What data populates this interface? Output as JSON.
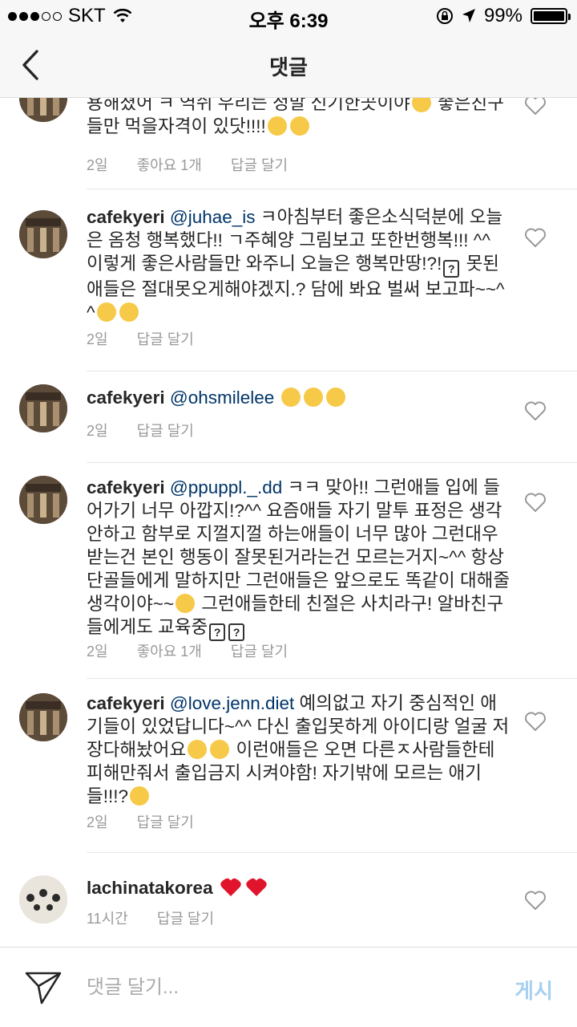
{
  "status": {
    "carrier": "SKT",
    "time": "오후 6:39",
    "battery": "99%",
    "battery_level": 0.99
  },
  "nav": {
    "title": "댓글"
  },
  "comments": [
    {
      "text": "용해졌어 ㅋ 역쉬 우리는 정말 신기한곳이야",
      "text2": " 좋은친구들만 먹을자격이 있닷!!!!",
      "time": "2일",
      "likes": "좋아요 1개",
      "reply": "답글 달기"
    },
    {
      "username": "cafekyeri",
      "mention": "@juhae_is",
      "text": " ㅋ아침부터 좋은소식덕분에 오늘은 옴청 행복했다!! ㄱ주혜양 그림보고 또한번행복!!! ^^ 이렇게 좋은사람들만 와주니 오늘은 행복만땅!?!",
      "text2": " 못된애들은 절대못오게해야겠지.? 담에 봐요 벌써 보고파~~^^",
      "time": "2일",
      "reply": "답글 달기"
    },
    {
      "username": "cafekyeri",
      "mention": "@ohsmilelee",
      "time": "2일",
      "reply": "답글 달기"
    },
    {
      "username": "cafekyeri",
      "mention": "@ppuppl._.dd",
      "text": " ㅋㅋ 맞아!! 그런애들 입에 들어가기 너무 아깝지!?^^ 요즘애들 자기 말투 표정은 생각안하고 함부로 지껄지껄 하는애들이 너무 많아 그런대우 받는건 본인 행동이 잘못된거라는건 모르는거지~^^ 항상 단골들에게 말하지만 그런애들은 앞으로도 똑같이 대해줄생각이야~~",
      "text2": " 그런애들한테 친절은 사치라구! 알바친구들에게도 교육중",
      "time": "2일",
      "likes": "좋아요 1개",
      "reply": "답글 달기"
    },
    {
      "username": "cafekyeri",
      "mention": "@love.jenn.diet",
      "text": " 예의없고 자기 중심적인 애기들이 있었답니다~^^ 다신 출입못하게 아이디랑 얼굴 저장다해놨어요",
      "text2": " 이런애들은 오면 다른ㅈ사람들한테 피해만줘서 출입금지 시켜야함! 자기밖에 모르는 애기들!!!?",
      "time": "2일",
      "reply": "답글 달기"
    },
    {
      "username": "lachinatakorea",
      "time": "11시간",
      "reply": "답글 달기"
    }
  ],
  "composer": {
    "placeholder": "댓글 달기...",
    "post_label": "게시"
  },
  "icons": {
    "back": "chevron-left-icon",
    "like": "heart-outline-icon",
    "send": "paper-plane-icon"
  },
  "colors": {
    "mention": "#003569",
    "meta": "#999999",
    "post_disabled": "#a8d0f0"
  }
}
